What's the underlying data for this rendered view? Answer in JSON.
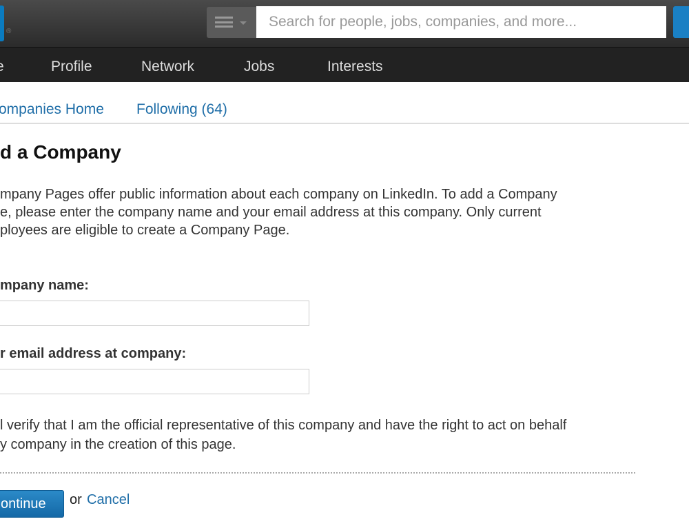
{
  "header": {
    "search_placeholder": "Search for people, jobs, companies, and more...",
    "registered_mark": "®"
  },
  "nav": {
    "items": [
      "e",
      "Profile",
      "Network",
      "Jobs",
      "Interests"
    ]
  },
  "subnav": {
    "items": [
      "ompanies Home",
      "Following (64)"
    ]
  },
  "main": {
    "title": "d a Company",
    "intro": [
      "mpany Pages offer public information about each company on LinkedIn. To add a Company",
      "e, please enter the company name and your email address at this company. Only current",
      "ployees are eligible to create a Company Page."
    ],
    "company_label": "mpany name:",
    "company_value": "",
    "email_label": "r email address at company:",
    "email_value": "",
    "verify": [
      "l verify that I am the official representative of this company and have the right to act on behalf",
      "y company in the creation of this page."
    ],
    "continue_label": "ontinue",
    "or": "or",
    "cancel_label": "Cancel"
  },
  "colors": {
    "link": "#1f6ea8",
    "button": "#1a78b8",
    "topbar": "#333333",
    "nav": "#222222"
  }
}
